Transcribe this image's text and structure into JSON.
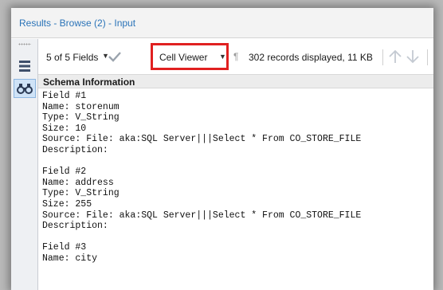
{
  "window": {
    "title": "Results - Browse (2) - Input"
  },
  "toolbar": {
    "fields_dropdown": "5 of 5 Fields",
    "viewer_dropdown": "Cell Viewer",
    "pilcrow": "¶",
    "records_info": "302 records displayed, 11 KB"
  },
  "sidebar": {
    "items": [
      {
        "icon": "list-view-icon"
      },
      {
        "icon": "binoculars-icon",
        "active": true
      }
    ]
  },
  "schema": {
    "header": "Schema Information",
    "lines": [
      "Field #1",
      "Name: storenum",
      "Type: V_String",
      "Size: 10",
      "Source: File: aka:SQL Server|||Select * From CO_STORE_FILE",
      "Description:",
      "",
      "Field #2",
      "Name: address",
      "Type: V_String",
      "Size: 255",
      "Source: File: aka:SQL Server|||Select * From CO_STORE_FILE",
      "Description:",
      "",
      "Field #3",
      "Name: city"
    ]
  },
  "colors": {
    "title_text": "#2a73b8",
    "highlight_border": "#e02020",
    "active_tool_bg": "#cfe3f7"
  }
}
